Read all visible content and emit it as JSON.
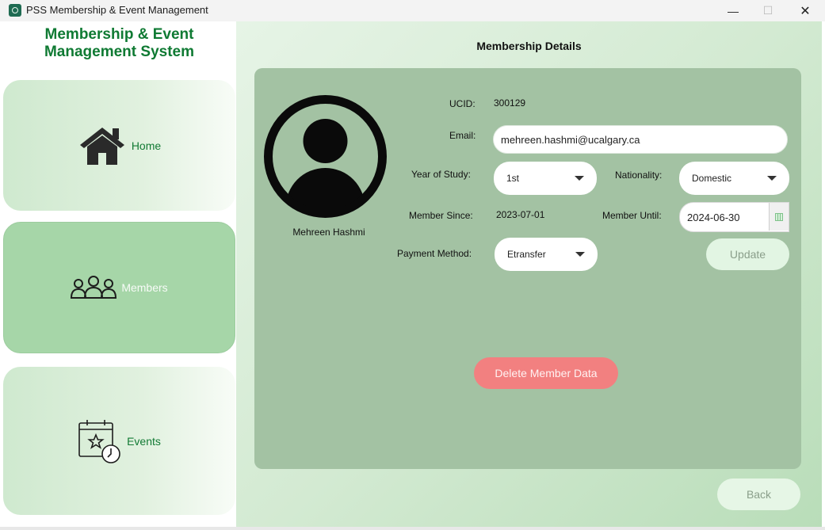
{
  "window": {
    "title": "PSS Membership & Event Management",
    "minimize_glyph": "—",
    "maximize_glyph": "☐",
    "close_glyph": "✕"
  },
  "sidebar": {
    "heading_line1": "Membership & Event",
    "heading_line2": "Management System",
    "items": [
      {
        "label": "Home",
        "icon": "house-icon",
        "active": false
      },
      {
        "label": "Members",
        "icon": "people-group-icon",
        "active": true
      },
      {
        "label": "Events",
        "icon": "calendar-clock-icon",
        "active": false
      }
    ]
  },
  "main": {
    "page_title": "Membership Details",
    "member": {
      "name": "Mehreen Hashmi",
      "avatar_icon": "user-avatar-icon",
      "ucid_label": "UCID:",
      "ucid": "300129",
      "email_label": "Email:",
      "email": "mehreen.hashmi@ucalgary.ca",
      "year_label": "Year of Study:",
      "year": "1st",
      "nationality_label": "Nationality:",
      "nationality": "Domestic",
      "since_label": "Member Since:",
      "since": "2023-07-01",
      "until_label": "Member Until:",
      "until": "2024-06-30",
      "payment_label": "Payment Method:",
      "payment": "Etransfer"
    },
    "buttons": {
      "update": "Update",
      "delete": "Delete Member Data",
      "back": "Back"
    }
  },
  "colors": {
    "brand_green": "#0f7a33",
    "active_nav": "#a6d6a8",
    "panel": "#a3c2a3",
    "delete_red": "#f28080"
  }
}
